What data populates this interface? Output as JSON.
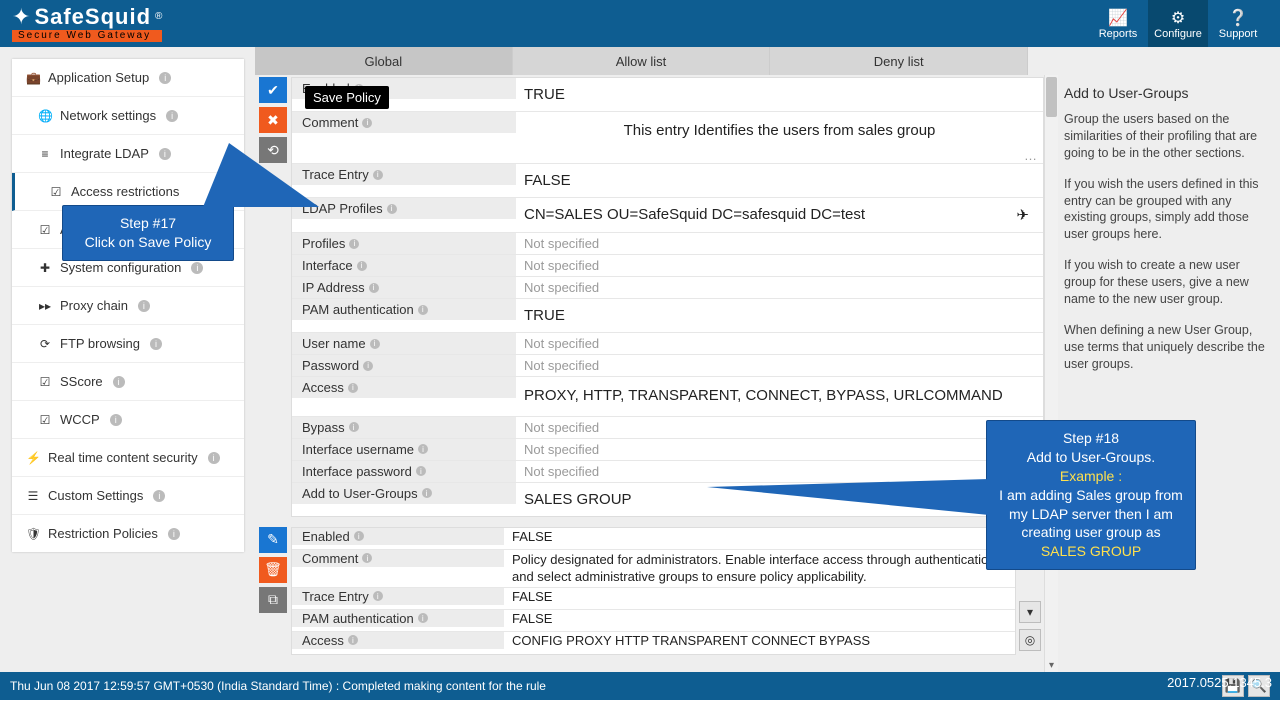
{
  "brand": {
    "name": "SafeSquid",
    "reg": "®",
    "tagline": "Secure Web Gateway"
  },
  "header": {
    "reports": "Reports",
    "configure": "Configure",
    "support": "Support"
  },
  "sidebar": {
    "items": [
      {
        "icon": "💼",
        "label": "Application Setup"
      },
      {
        "icon": "🌐",
        "label": "Network settings"
      },
      {
        "icon": "≡",
        "label": "Integrate LDAP"
      },
      {
        "icon": "☑",
        "label": "Access restrictions"
      },
      {
        "icon": "☑",
        "label": "Accelerators"
      },
      {
        "icon": "✚",
        "label": "System configuration"
      },
      {
        "icon": "▸",
        "label": "Proxy chain"
      },
      {
        "icon": "⟳",
        "label": "FTP browsing"
      },
      {
        "icon": "☑",
        "label": "SScore"
      },
      {
        "icon": "☑",
        "label": "WCCP"
      },
      {
        "icon": "⚡",
        "label": "Real time content security"
      },
      {
        "icon": "⚙",
        "label": "Custom Settings"
      },
      {
        "icon": "🛡",
        "label": "Restriction Policies"
      }
    ]
  },
  "tabs": {
    "global": "Global",
    "allow": "Allow list",
    "deny": "Deny list"
  },
  "tooltip": "Save Policy",
  "policy1": {
    "enabled": {
      "label": "Enabled",
      "value": "TRUE"
    },
    "comment": {
      "label": "Comment",
      "value": "This entry Identifies the users from sales group"
    },
    "trace": {
      "label": "Trace Entry",
      "value": "FALSE"
    },
    "ldap": {
      "label": "LDAP Profiles",
      "value": "CN=SALES OU=SafeSquid DC=safesquid DC=test"
    },
    "profiles": {
      "label": "Profiles",
      "value": "Not specified"
    },
    "interface": {
      "label": "Interface",
      "value": "Not specified"
    },
    "ip": {
      "label": "IP Address",
      "value": "Not specified"
    },
    "pam": {
      "label": "PAM authentication",
      "value": "TRUE"
    },
    "user": {
      "label": "User name",
      "value": "Not specified"
    },
    "pass": {
      "label": "Password",
      "value": "Not specified"
    },
    "access": {
      "label": "Access",
      "value": "PROXY,  HTTP,  TRANSPARENT,  CONNECT,  BYPASS,  URLCOMMAND"
    },
    "bypass": {
      "label": "Bypass",
      "value": "Not specified"
    },
    "ifuser": {
      "label": "Interface username",
      "value": "Not specified"
    },
    "ifpass": {
      "label": "Interface password",
      "value": "Not specified"
    },
    "addug": {
      "label": "Add to User-Groups",
      "value": "SALES GROUP"
    }
  },
  "policy2": {
    "enabled": {
      "label": "Enabled",
      "value": "FALSE"
    },
    "comment": {
      "label": "Comment",
      "value": "Policy designated for administrators. Enable interface access through authentication and select administrative groups to ensure policy applicability."
    },
    "trace": {
      "label": "Trace Entry",
      "value": "FALSE"
    },
    "pam": {
      "label": "PAM authentication",
      "value": "FALSE"
    },
    "access": {
      "label": "Access",
      "value": "CONFIG  PROXY  HTTP  TRANSPARENT  CONNECT  BYPASS"
    }
  },
  "help": {
    "title": "Add to User-Groups",
    "p1": "Group the users based on the similarities of their profiling that are going to be in the other sections.",
    "p2": "If you wish the users defined in this entry can be grouped with any existing groups, simply add those user groups here.",
    "p3": "If you wish to create a new user group for these users, give a new name to the new user group.",
    "p4": "When defining a new User Group, use terms that uniquely describe the user groups."
  },
  "callouts": {
    "c17_l1": "Step #17",
    "c17_l2": "Click on Save Policy",
    "c18_l1": "Step #18",
    "c18_l2": "Add to User-Groups.",
    "c18_ex": "Example :",
    "c18_l3": "I am adding Sales group from my LDAP server then I am creating user group as",
    "c18_l4": "SALES GROUP"
  },
  "footer": {
    "status": "Thu Jun 08 2017 12:59:57 GMT+0530 (India Standard Time) : Completed making content for the rule",
    "build": "2017.0525.1345.3"
  }
}
